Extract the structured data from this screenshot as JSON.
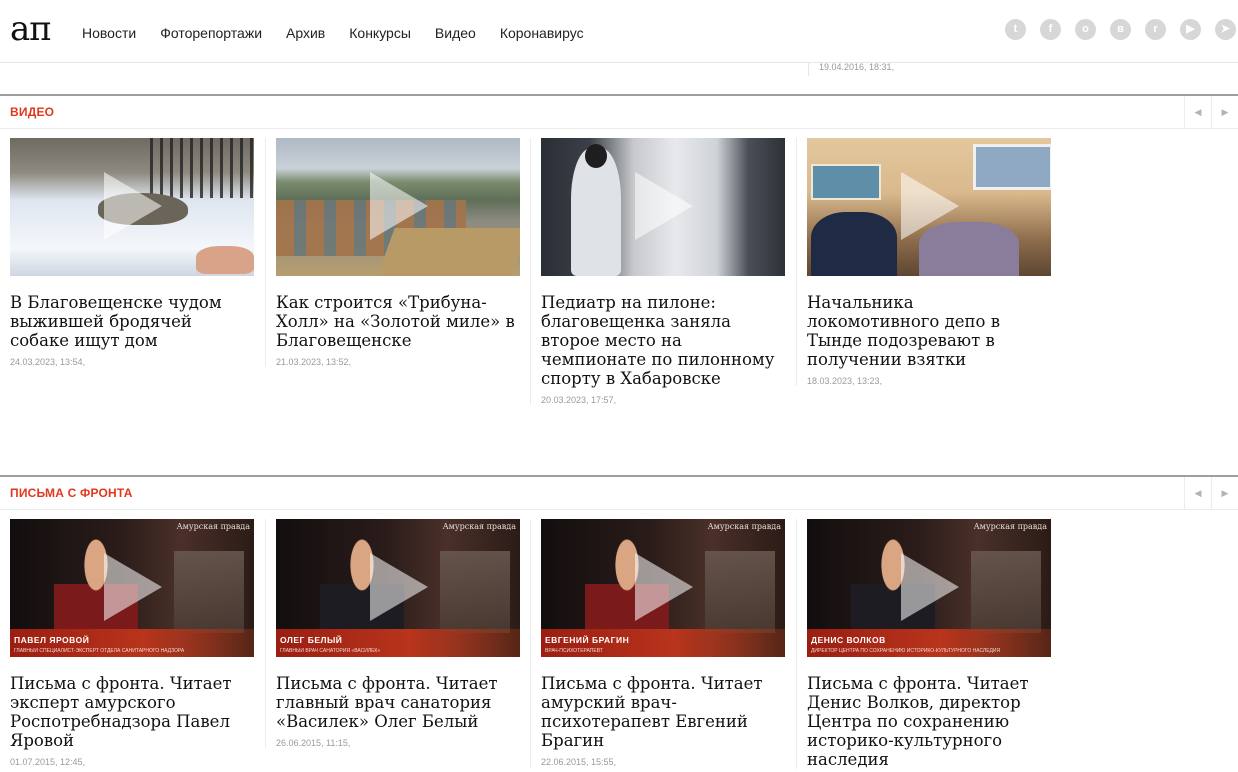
{
  "header": {
    "logo": "ап",
    "nav": [
      "Новости",
      "Фоторепортажи",
      "Архив",
      "Конкурсы",
      "Видео",
      "Коронавирус"
    ],
    "socials": [
      {
        "icon": "twitter-icon",
        "glyph": "t"
      },
      {
        "icon": "facebook-icon",
        "glyph": "f"
      },
      {
        "icon": "odnoklassniki-icon",
        "glyph": "o"
      },
      {
        "icon": "vk-icon",
        "glyph": "в"
      },
      {
        "icon": "reddit-icon",
        "glyph": "r"
      },
      {
        "icon": "youtube-icon",
        "glyph": "▶"
      },
      {
        "icon": "telegram-icon",
        "glyph": "➤"
      }
    ]
  },
  "previous_date": "19.04.2016, 18:31,",
  "sections": {
    "video": {
      "title": "ВИДЕО",
      "cards": [
        {
          "title": "В Благовещенске чудом выжившей бродячей собаке ищут дом",
          "date": "24.03.2023, 13:54,"
        },
        {
          "title": "Как строится «Трибуна-Холл» на «Золотой миле» в Благовещенске",
          "date": "21.03.2023, 13:52,"
        },
        {
          "title": "Педиатр на пилоне: благовещенка заняла второе место на чемпионате по пилонному спорту в Хабаровске",
          "date": "20.03.2023, 17:57,"
        },
        {
          "title": "Начальника локомотивного депо в Тынде подозревают в получении взятки",
          "date": "18.03.2023, 13:23,"
        }
      ]
    },
    "letters": {
      "title": "ПИСЬМА С ФРОНТА",
      "brand": "Амурская правда",
      "cards": [
        {
          "title": "Письма с фронта. Читает эксперт амурского Роспотребнадзора Павел Яровой",
          "date": "01.07.2015, 12:45,",
          "name": "ПАВЕЛ ЯРОВОЙ",
          "role": "ГЛАВНЫЙ СПЕЦИАЛИСТ-ЭКСПЕРТ ОТДЕЛА САНИТАРНОГО НАДЗОРА"
        },
        {
          "title": "Письма с фронта. Читает главный врач санатория «Василек» Олег Белый",
          "date": "26.06.2015, 11:15,",
          "name": "ОЛЕГ БЕЛЫЙ",
          "role": "ГЛАВНЫЙ ВРАЧ САНАТОРИЯ «ВАСИЛЕК»"
        },
        {
          "title": "Письма с фронта. Читает амурский врач-психотерапевт Евгений Брагин",
          "date": "22.06.2015, 15:55,",
          "name": "ЕВГЕНИЙ БРАГИН",
          "role": "ВРАЧ-ПСИХОТЕРАПЕВТ"
        },
        {
          "title": "Письма с фронта. Читает Денис Волков, директор Центра по сохранению историко-культурного наследия",
          "date": "",
          "name": "ДЕНИС ВОЛКОВ",
          "role": "ДИРЕКТОР ЦЕНТРА ПО СОХРАНЕНИЮ ИСТОРИКО-КУЛЬТУРНОГО НАСЛЕДИЯ"
        }
      ]
    }
  },
  "arrows": {
    "prev": "◀",
    "next": "▶"
  }
}
